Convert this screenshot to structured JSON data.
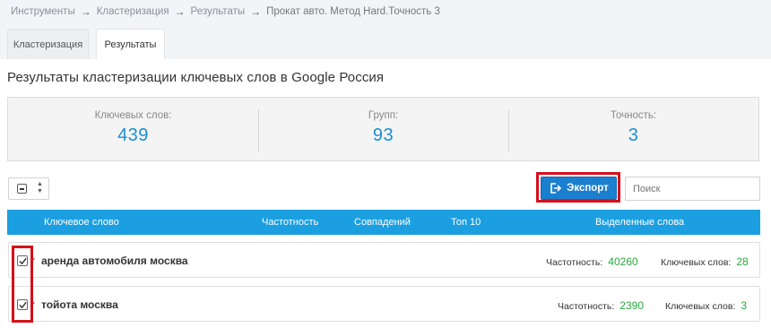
{
  "breadcrumb": {
    "items": [
      "Инструменты",
      "Кластеризация",
      "Результаты"
    ],
    "current": "Прокат авто. Метод Hard.Точность 3",
    "separator": "→"
  },
  "tabs": [
    {
      "label": "Кластеризация",
      "active": false
    },
    {
      "label": "Результаты",
      "active": true
    }
  ],
  "page_title": "Результаты кластеризации ключевых слов в Google Россия",
  "stats": [
    {
      "label": "Ключевых слов:",
      "value": "439"
    },
    {
      "label": "Групп:",
      "value": "93"
    },
    {
      "label": "Точность:",
      "value": "3"
    }
  ],
  "toolbar": {
    "export_label": "Экспорт",
    "search_placeholder": "Поиск"
  },
  "table": {
    "columns": [
      "Ключевое слово",
      "Частотность",
      "Совпадений",
      "Топ 10",
      "Выделенные слова"
    ],
    "rows": [
      {
        "keyword": "аренда автомобиля москва",
        "freq_label": "Частотность:",
        "freq": "40260",
        "kw_label": "Ключевых слов:",
        "kw_count": "28",
        "checked": true
      },
      {
        "keyword": "тойота москва",
        "freq_label": "Частотность:",
        "freq": "2390",
        "kw_label": "Ключевых слов:",
        "kw_count": "3",
        "checked": true
      }
    ]
  },
  "colors": {
    "accent": "#1b9fe0",
    "button": "#1b7fcf",
    "stat_value": "#1a8fd1",
    "highlight_frame": "#d5101a",
    "count_green": "#2aa83f"
  }
}
